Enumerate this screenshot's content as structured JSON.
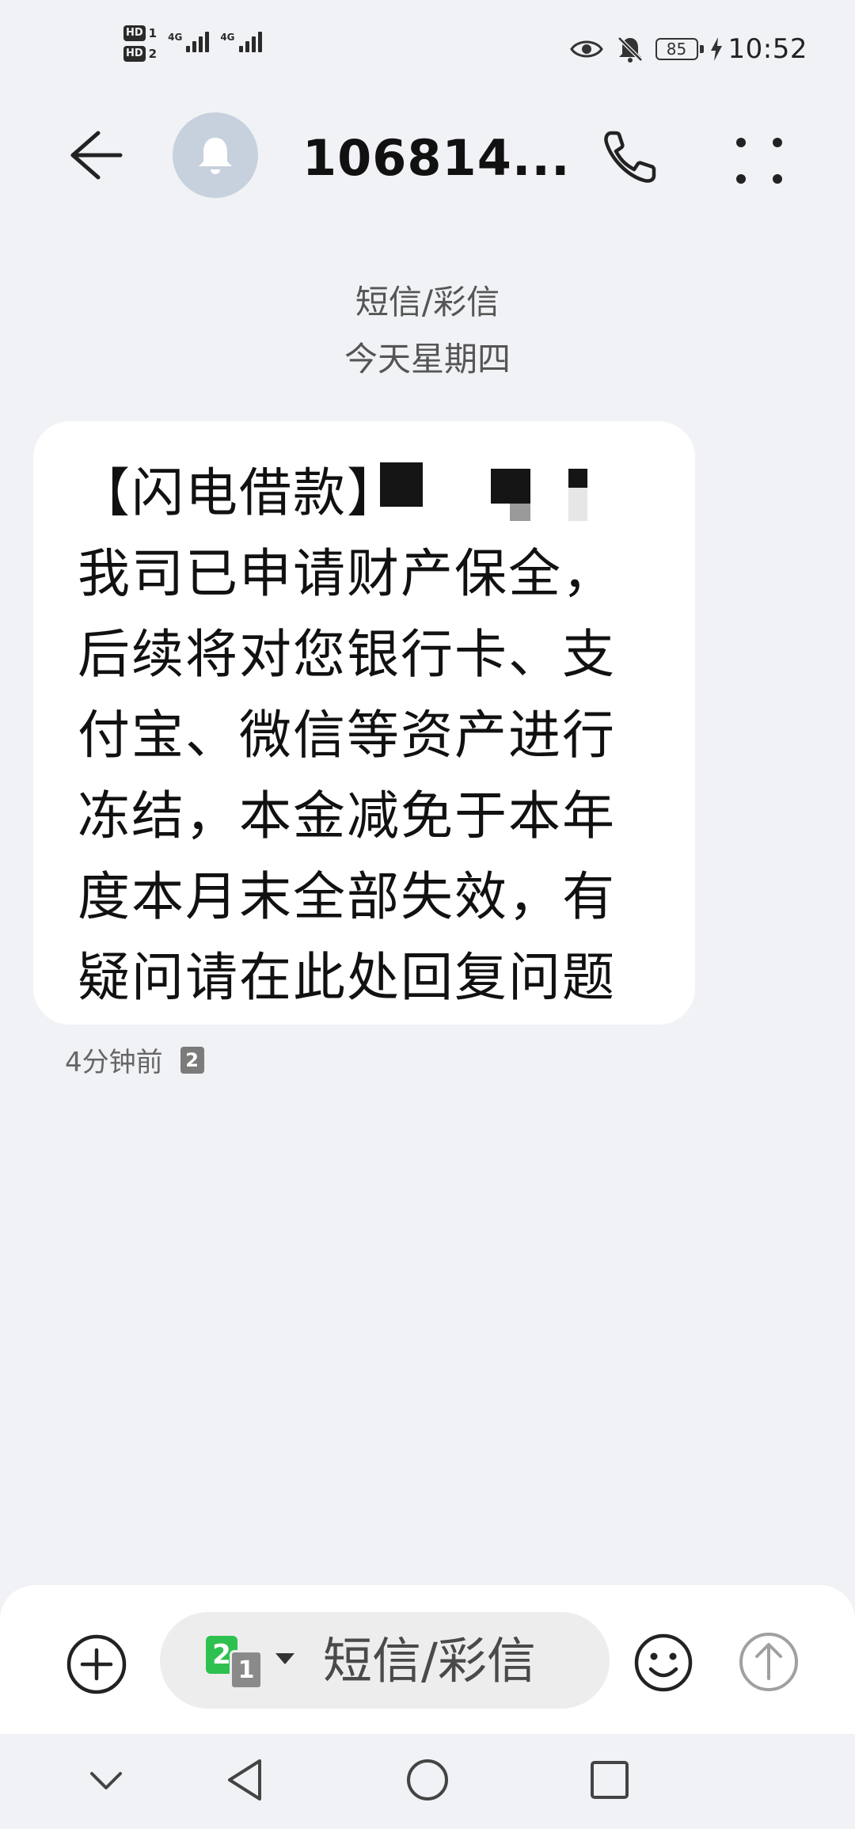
{
  "status_bar": {
    "hd1": "HD",
    "sim1_num": "1",
    "hd2": "HD",
    "sim2_num": "2",
    "net1": "4G",
    "net2": "4G",
    "battery_level": "85",
    "time": "10:52"
  },
  "header": {
    "contact_title": "106814...",
    "avatar_icon": "bell-icon",
    "back_icon": "arrow-left-icon",
    "call_icon": "phone-icon",
    "more_icon": "more-dots-icon"
  },
  "conversation": {
    "message_type": "短信/彩信",
    "date_label": "今天星期四",
    "messages": [
      {
        "line1": "【闪电借款】",
        "body": "我司已申请财产保全，\n后续将对您银行卡、支\n付宝、微信等资产进行\n冻结，本金减免于本年\n度本月末全部失效，有\n疑问请在此处回复问题",
        "time": "4分钟前",
        "sim": "2"
      }
    ]
  },
  "composer": {
    "sim_active": "2",
    "sim_other": "1",
    "placeholder": "短信/彩信",
    "add_icon": "plus-circle-icon",
    "emoji_icon": "smiley-icon",
    "send_icon": "send-arrow-icon"
  },
  "colors": {
    "background": "#f1f2f5",
    "bubble": "#ffffff",
    "sim_green": "#2fc14f",
    "avatar_bg": "#c7d1dd"
  }
}
